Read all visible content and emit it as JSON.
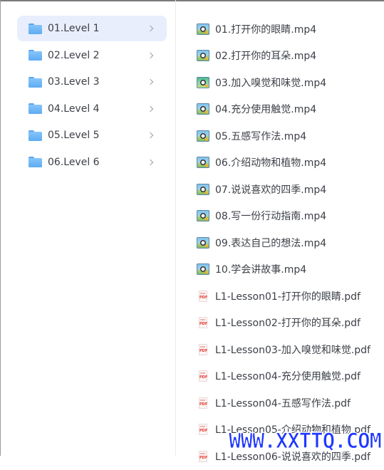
{
  "folders": [
    {
      "label": "01.Level 1"
    },
    {
      "label": "02.Level 2"
    },
    {
      "label": "03.Level 3"
    },
    {
      "label": "04.Level 4"
    },
    {
      "label": "05.Level 5"
    },
    {
      "label": "06.Level 6"
    }
  ],
  "files": [
    {
      "name": "01.打开你的眼睛.mp4"
    },
    {
      "name": "02.打开你的耳朵.mp4"
    },
    {
      "name": "03.加入嗅觉和味觉.mp4"
    },
    {
      "name": "04.充分使用触觉.mp4"
    },
    {
      "name": "05.五感写作法.mp4"
    },
    {
      "name": "06.介绍动物和植物.mp4"
    },
    {
      "name": "07.说说喜欢的四季.mp4"
    },
    {
      "name": "08.写一份行动指南.mp4"
    },
    {
      "name": "09.表达自己的想法.mp4"
    },
    {
      "name": "10.学会讲故事.mp4"
    },
    {
      "name": "L1-Lesson01-打开你的眼睛.pdf"
    },
    {
      "name": "L1-Lesson02-打开你的耳朵.pdf"
    },
    {
      "name": "L1-Lesson03-加入嗅觉和味觉.pdf"
    },
    {
      "name": "L1-Lesson04-充分使用触觉.pdf"
    },
    {
      "name": "L1-Lesson04-五感写作法.pdf"
    },
    {
      "name": "L1-Lesson05-介绍动物和植物.pdf"
    },
    {
      "name": "L1-Lesson06-说说喜欢的四季.pdf"
    }
  ],
  "icons": {
    "pdf_tag": "PDF"
  },
  "watermark": {
    "text": "WWW.XXTTQ.COM"
  }
}
